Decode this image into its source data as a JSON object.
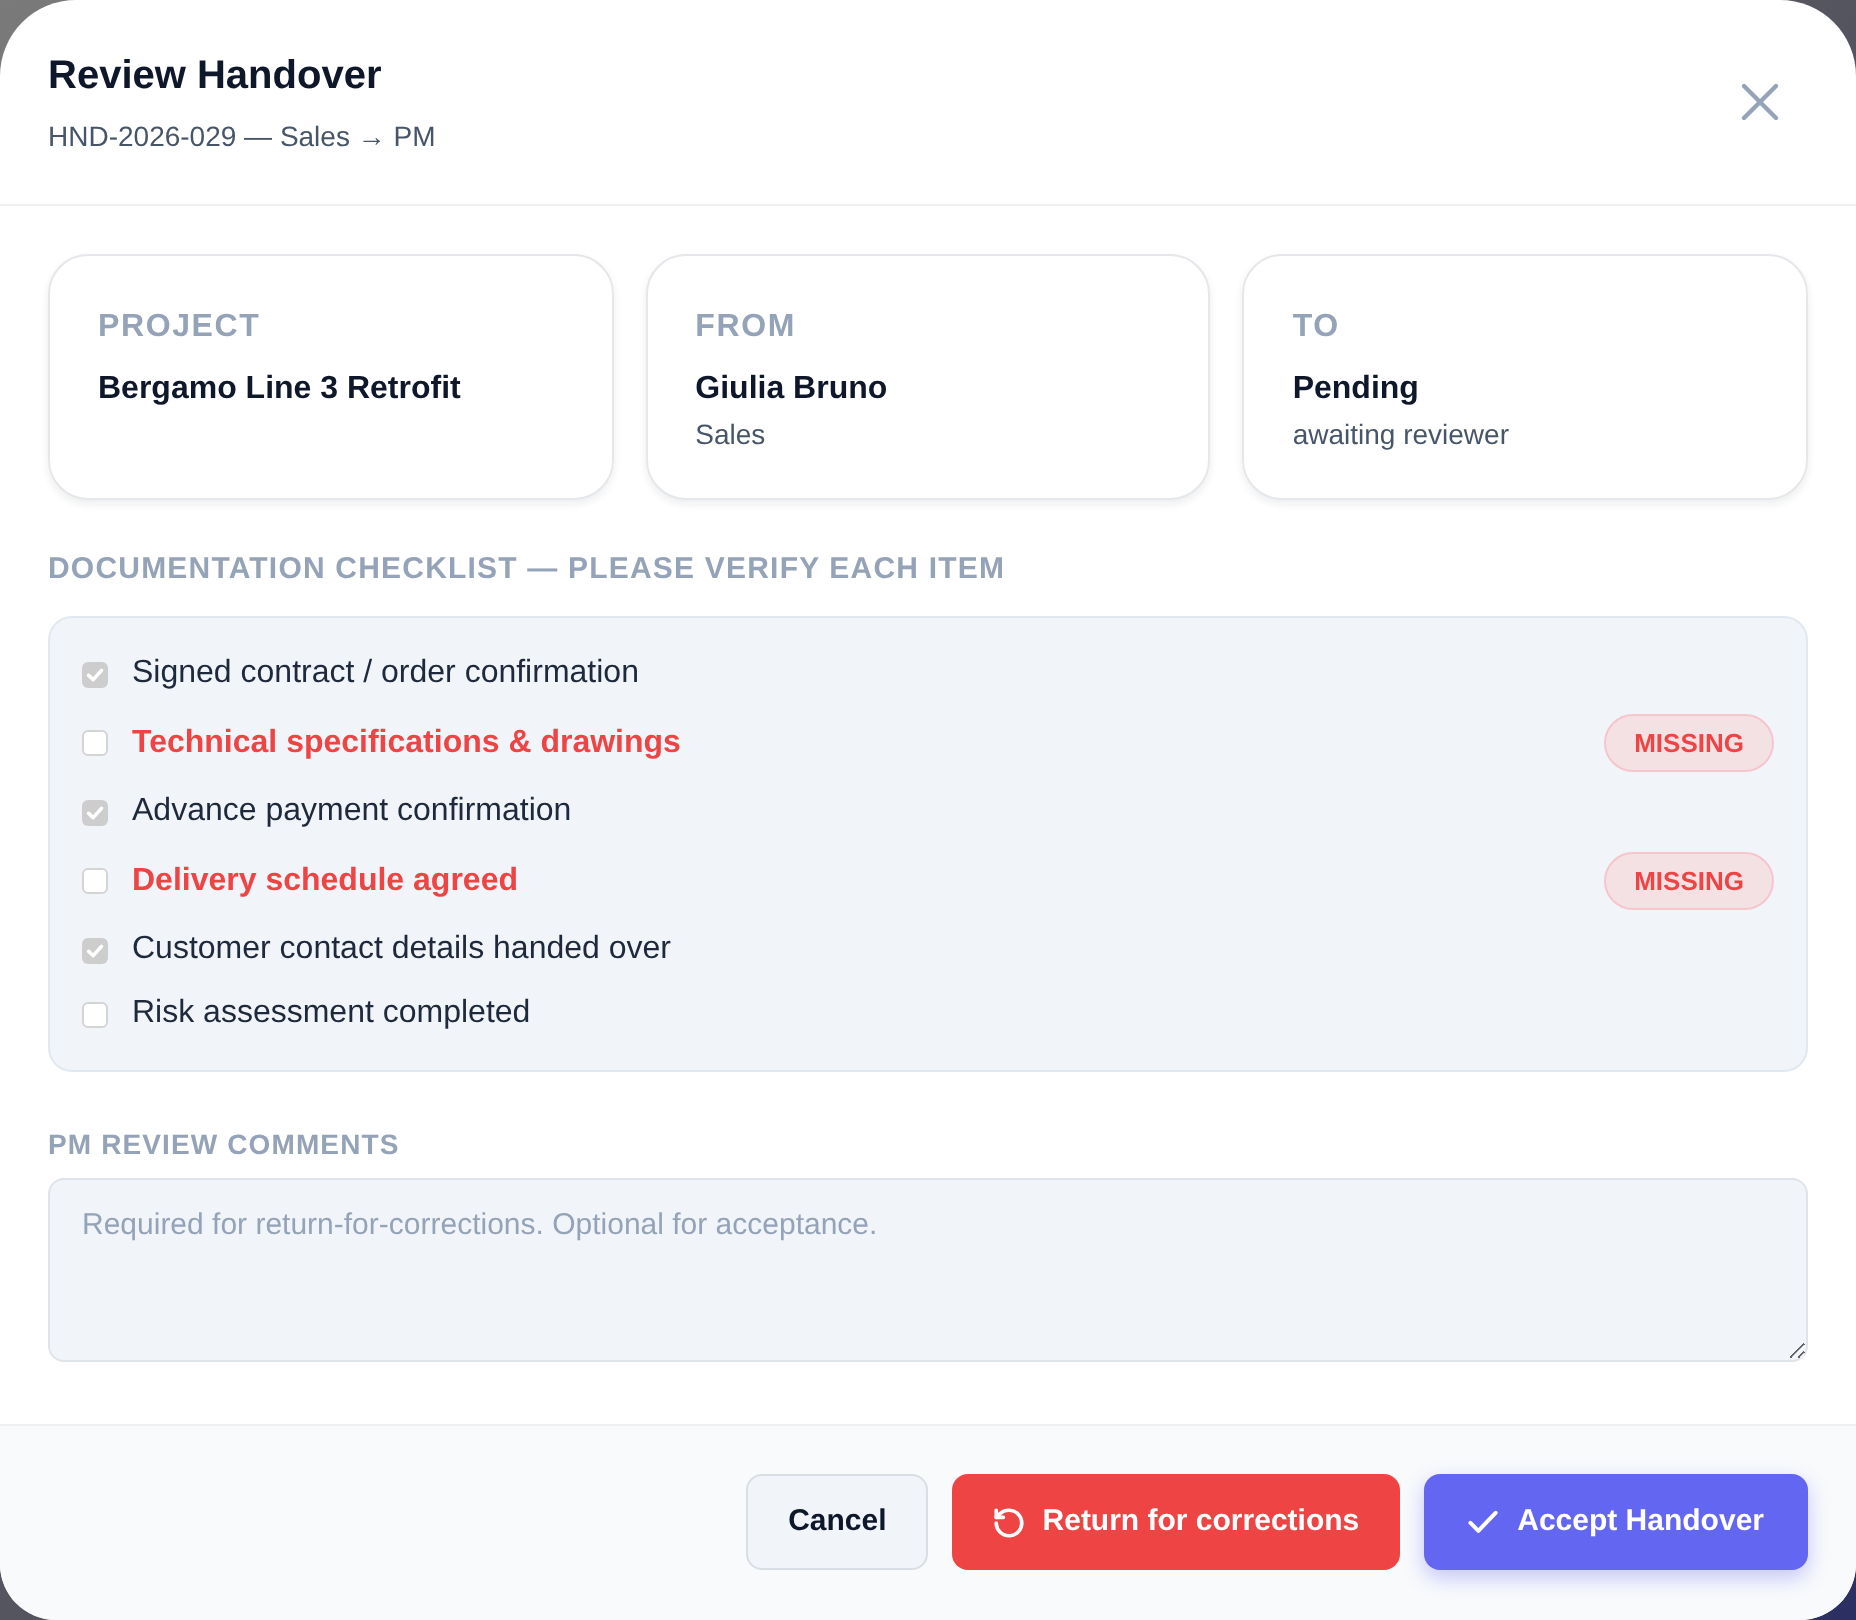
{
  "dialog": {
    "title": "Review Handover",
    "subtitle": "HND-2026-029 — Sales → PM"
  },
  "info_cards": [
    {
      "label": "PROJECT",
      "value": "Bergamo Line 3 Retrofit"
    },
    {
      "label": "FROM",
      "value": "Giulia Bruno",
      "detail": "Sales"
    },
    {
      "label": "TO",
      "value": "Pending",
      "detail": "awaiting reviewer"
    }
  ],
  "checklist": {
    "heading": "DOCUMENTATION CHECKLIST — PLEASE VERIFY EACH ITEM",
    "items": [
      {
        "label": "Signed contract / order confirmation",
        "checked": true,
        "missing": false
      },
      {
        "label": "Technical specifications & drawings",
        "checked": false,
        "missing": true,
        "badge": "MISSING"
      },
      {
        "label": "Advance payment confirmation",
        "checked": true,
        "missing": false
      },
      {
        "label": "Delivery schedule agreed",
        "checked": false,
        "missing": true,
        "badge": "MISSING"
      },
      {
        "label": "Customer contact details handed over",
        "checked": true,
        "missing": false
      },
      {
        "label": "Risk assessment completed",
        "checked": false,
        "missing": false
      }
    ]
  },
  "comments": {
    "label": "PM REVIEW COMMENTS",
    "placeholder": "Required for return-for-corrections. Optional for acceptance."
  },
  "buttons": [
    {
      "label": "Cancel",
      "kind": "secondary"
    },
    {
      "label": "Return for corrections",
      "kind": "danger"
    },
    {
      "label": "Accept Handover",
      "kind": "primary"
    }
  ]
}
